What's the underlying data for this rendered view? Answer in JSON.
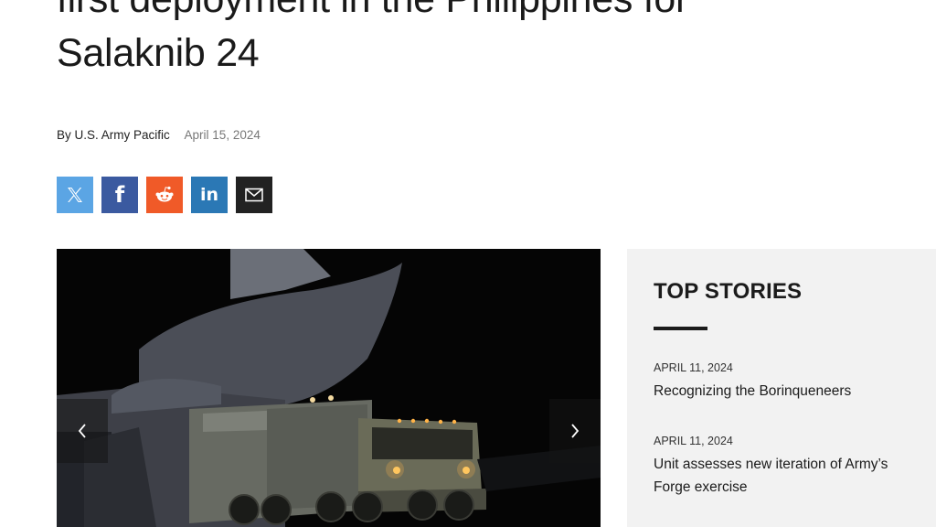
{
  "article": {
    "headline_lines": [
      "first deployment in the Philippines for",
      "Salaknib 24"
    ],
    "author": "By U.S. Army Pacific",
    "date": "April 15, 2024"
  },
  "share": {
    "icons": [
      "x-icon",
      "facebook-icon",
      "reddit-icon",
      "linkedin-icon",
      "email-icon"
    ],
    "glyphs": {
      "facebook": "f",
      "linkedin": "in"
    },
    "colors": {
      "x": "#5ba5e4",
      "facebook": "#3b5aa0",
      "reddit": "#f05a28",
      "linkedin": "#2b78b5",
      "email": "#222222"
    }
  },
  "hero": {
    "prev_icon": "chevron-left-icon",
    "next_icon": "chevron-right-icon"
  },
  "sidebar": {
    "title": "TOP STORIES",
    "stories": [
      {
        "date": "APRIL 11, 2024",
        "title": "Recognizing the Borinqueneers"
      },
      {
        "date": "APRIL 11, 2024",
        "title": "Unit assesses new iteration of Army’s Forge exercise"
      }
    ]
  }
}
